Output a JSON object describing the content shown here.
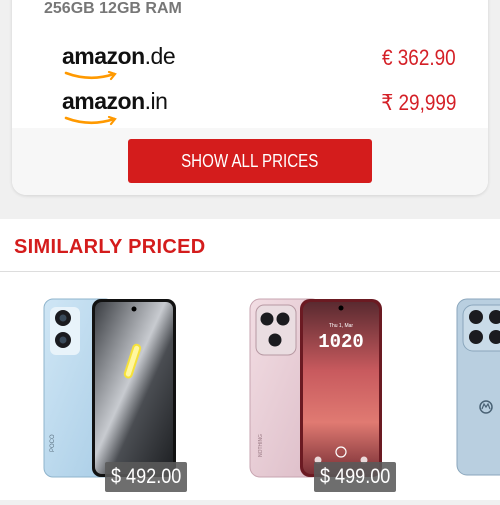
{
  "offers_card": {
    "spec": "256GB 12GB RAM",
    "stores": [
      {
        "brand": "amazon",
        "tld": ".de",
        "price": "€ 362.90"
      },
      {
        "brand": "amazon",
        "tld": ".in",
        "price": "₹ 29,999"
      }
    ],
    "show_all_label": "SHOW ALL PRICES"
  },
  "similar": {
    "title": "SIMILARLY PRICED",
    "products": [
      {
        "price": "$ 492.00"
      },
      {
        "price": "$ 499.00"
      }
    ]
  },
  "colors": {
    "accent_red": "#d41c1c",
    "price_red": "#d41f26",
    "amazon_orange": "#ff9900"
  }
}
